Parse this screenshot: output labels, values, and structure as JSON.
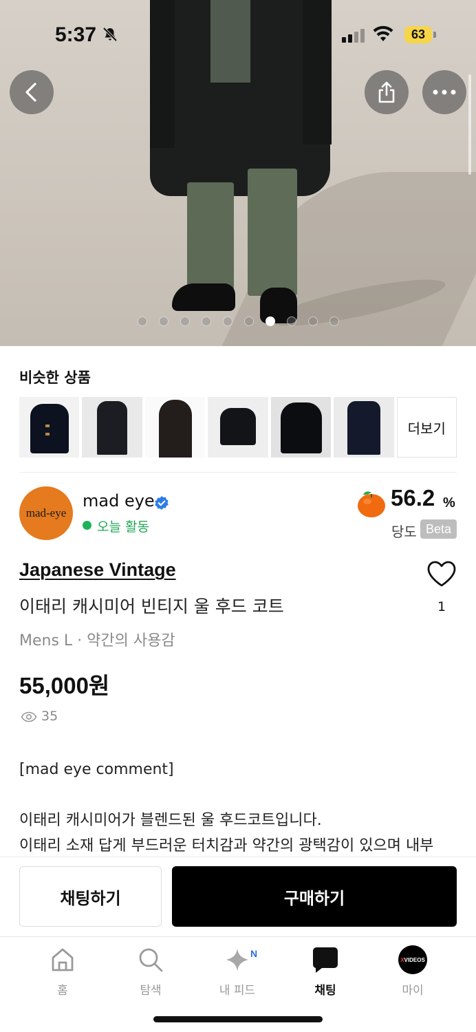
{
  "status_bar": {
    "time": "5:37",
    "battery": "63",
    "battery_color": "#f7d54a"
  },
  "gallery": {
    "image_count": 10,
    "active_index": 6
  },
  "icons": {
    "back": "chevron-left-icon",
    "share": "share-icon",
    "more": "more-horizontal-icon",
    "verified": "verified-badge-icon",
    "like": "heart-icon",
    "views": "eye-icon"
  },
  "similar": {
    "title": "비슷한 상품",
    "more_label": "더보기",
    "item_count": 7
  },
  "seller": {
    "avatar_text": "mad-eye",
    "name": "mad eye",
    "activity": "오늘 활동",
    "activity_color": "#1ea854",
    "sweetness_value": "56.2",
    "sweetness_unit": "%",
    "sweetness_label": "당도",
    "beta_label": "Beta"
  },
  "product": {
    "brand": "Japanese Vintage",
    "title": "이태리 캐시미어 빈티지 울 후드 코트",
    "meta": "Mens L · 약간의 사용감",
    "price": "55,000원",
    "views": "35",
    "likes": "1",
    "description": {
      "line1": "[mad eye comment]",
      "line2": "이태리 캐시미어가 블렌드된 울 후드코트입니다.",
      "line3": "이태리 소재 답게 부드러운 터치감과 약간의 광택감이 있으며 내부"
    }
  },
  "actions": {
    "chat": "채팅하기",
    "buy": "구매하기"
  },
  "tabs": {
    "home": "홈",
    "search": "탐색",
    "feed": "내 피드",
    "feed_badge": "N",
    "chat": "채팅",
    "my": "마이",
    "my_avatar_a": "X",
    "my_avatar_b": "VIDEOS",
    "active": "chat"
  }
}
